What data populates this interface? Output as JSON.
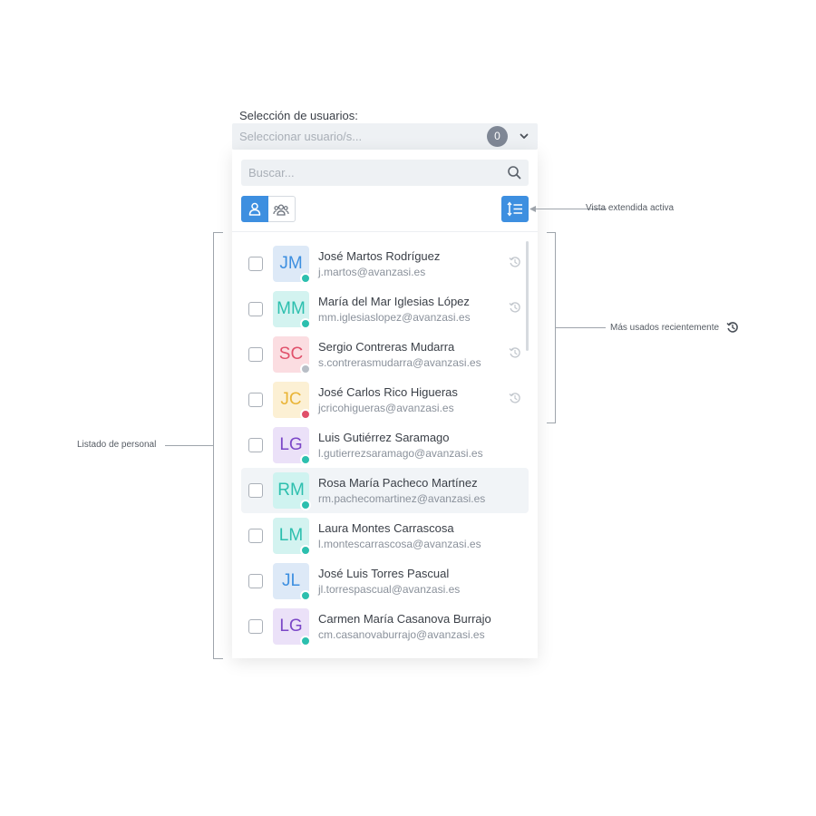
{
  "field": {
    "label": "Selección de usuarios:",
    "placeholder": "Seleccionar usuario/s...",
    "selected_count": "0"
  },
  "search": {
    "placeholder": "Buscar..."
  },
  "annotations": {
    "extended_view": "Vista extendida activa",
    "recent": "Más usados recientemente",
    "list": "Listado de personal"
  },
  "colors": {
    "accent": "#3d8fe0",
    "online": "#2cbfae",
    "away": "#b8bec6",
    "busy": "#e0506a"
  },
  "users": [
    {
      "initials": "JM",
      "name": "José Martos Rodríguez",
      "email": "j.martos@avanzasi.es",
      "bg": "#dde9f7",
      "fg": "#3d8fe0",
      "status": "#2cbfae",
      "recent": true
    },
    {
      "initials": "MM",
      "name": "María del Mar Iglesias López",
      "email": "mm.iglesiaslopez@avanzasi.es",
      "bg": "#d3f3f0",
      "fg": "#2cbfae",
      "status": "#2cbfae",
      "recent": true
    },
    {
      "initials": "SC",
      "name": "Sergio Contreras Mudarra",
      "email": "s.contrerasmudarra@avanzasi.es",
      "bg": "#fbdde1",
      "fg": "#e0506a",
      "status": "#b8bec6",
      "recent": true
    },
    {
      "initials": "JC",
      "name": "José Carlos Rico Higueras",
      "email": "jcricohigueras@avanzasi.es",
      "bg": "#fcf0d4",
      "fg": "#e9b436",
      "status": "#e0506a",
      "recent": true
    },
    {
      "initials": "LG",
      "name": "Luis Gutiérrez Saramago",
      "email": "l.gutierrezsaramago@avanzasi.es",
      "bg": "#ebe1f8",
      "fg": "#7b47c7",
      "status": "#2cbfae",
      "recent": false
    },
    {
      "initials": "RM",
      "name": "Rosa María Pacheco Martínez",
      "email": "rm.pachecomartinez@avanzasi.es",
      "bg": "#cff3f0",
      "fg": "#2cbfae",
      "status": "#2cbfae",
      "recent": false,
      "hover": true
    },
    {
      "initials": "LM",
      "name": "Laura Montes Carrascosa",
      "email": "l.montescarrascosa@avanzasi.es",
      "bg": "#d3f3f0",
      "fg": "#2cbfae",
      "status": "#2cbfae",
      "recent": false
    },
    {
      "initials": "JL",
      "name": "José Luis Torres Pascual",
      "email": "jl.torrespascual@avanzasi.es",
      "bg": "#dde9f7",
      "fg": "#3d8fe0",
      "status": "#2cbfae",
      "recent": false
    },
    {
      "initials": "LG",
      "name": "Carmen María Casanova Burrajo",
      "email": "cm.casanovaburrajo@avanzasi.es",
      "bg": "#ebe1f8",
      "fg": "#7b47c7",
      "status": "#2cbfae",
      "recent": false
    }
  ]
}
